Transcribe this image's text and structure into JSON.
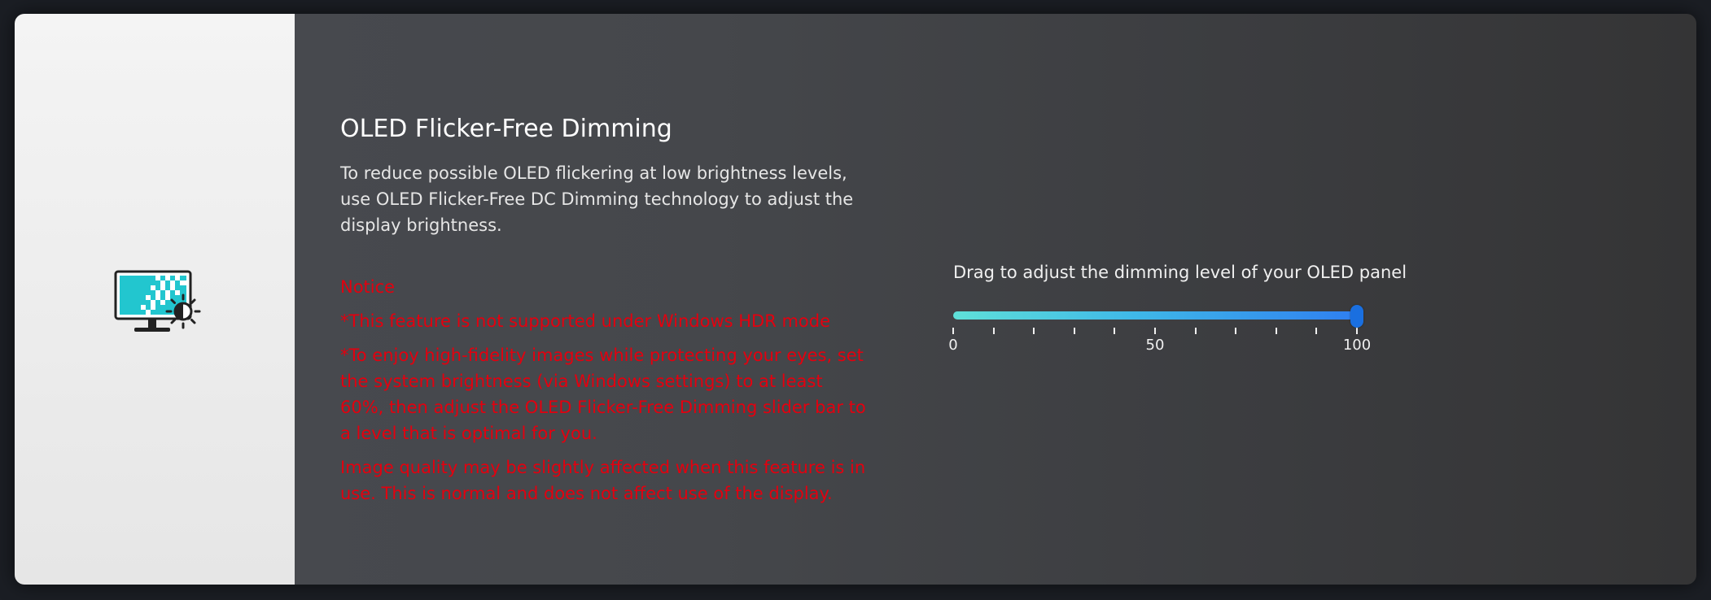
{
  "feature": {
    "title": "OLED Flicker-Free Dimming",
    "description": "To reduce possible OLED flickering at low brightness levels, use OLED Flicker-Free DC Dimming technology to adjust the display brightness."
  },
  "notice": {
    "title": "Notice",
    "line1": "*This feature is not supported under Windows HDR mode",
    "line2": "*To enjoy high-fidelity images while protecting your eyes, set the system brightness (via Windows settings) to at least 60%, then adjust the OLED Flicker-Free Dimming slider bar to a level that is optimal for you.",
    "line3": "Image quality may be slightly affected when this feature is in use. This is normal and does not affect use of the display.",
    "color": "#e3000f"
  },
  "slider": {
    "label": "Drag to adjust the dimming level of your OLED panel",
    "min": 0,
    "max": 100,
    "value": 100,
    "tick_count": 11,
    "tick_labels": [
      "0",
      "50",
      "100"
    ],
    "track_gradient": [
      "#5fe0d8",
      "#2f7ff0"
    ],
    "thumb_color": "#1a6fe0"
  },
  "icons": {
    "feature_icon": "monitor-brightness-icon"
  }
}
